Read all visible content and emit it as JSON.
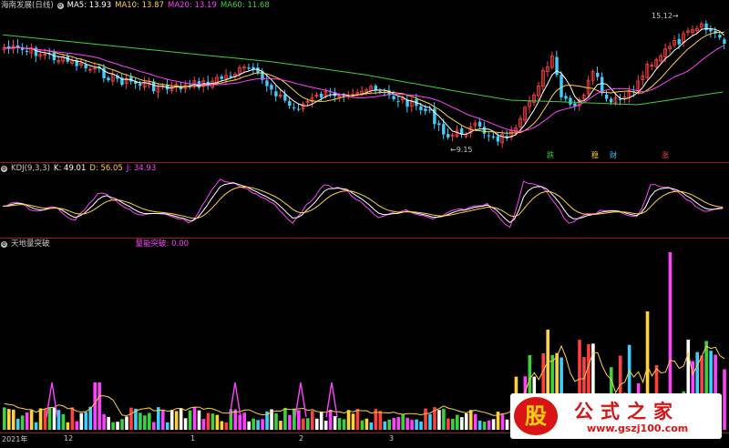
{
  "main_panel": {
    "title": "海南发展(日线)",
    "legend": [
      {
        "label": "MA5: 13.93",
        "color": "#ffffff"
      },
      {
        "label": "MA10: 13.87",
        "color": "#ffd23c"
      },
      {
        "label": "MA20: 13.19",
        "color": "#ff40ff"
      },
      {
        "label": "MA60: 11.68",
        "color": "#3cd23c"
      }
    ],
    "high_label": "15.12",
    "low_label": "9.15",
    "tags": [
      {
        "text": "跌",
        "color": "#3cd23c"
      },
      {
        "text": "稳",
        "color": "#ffd23c"
      },
      {
        "text": "财",
        "color": "#3ccfff"
      },
      {
        "text": "涨",
        "color": "#ff4040"
      }
    ]
  },
  "kdj_panel": {
    "title": "KDJ(9,3,3)",
    "legend": [
      {
        "label": "K: 49.01",
        "color": "#ffffff"
      },
      {
        "label": "D: 56.05",
        "color": "#ffd23c"
      },
      {
        "label": "J: 34.93",
        "color": "#ff40ff"
      }
    ]
  },
  "volume_panel": {
    "title": "天地量突破",
    "indicator": {
      "label": "量能突破: 0.00",
      "color": "#ff40ff"
    }
  },
  "x_axis": {
    "labels": [
      "2021年",
      "12",
      "1",
      "2",
      "3"
    ]
  },
  "watermark": {
    "logo": "股",
    "title": "公式之家",
    "url": "www.gszj100.com"
  },
  "colors": {
    "up": "#ff4040",
    "down": "#3ccfff",
    "ma5": "#ffffff",
    "ma10": "#ffd23c",
    "ma20": "#ff40ff",
    "ma60": "#3cd23c",
    "kdj_j": "#ff40ff",
    "separator": "#9a1a1a"
  }
}
